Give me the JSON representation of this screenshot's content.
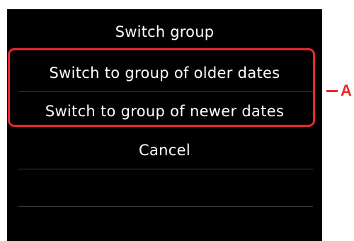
{
  "screen": {
    "title": "Switch group",
    "menu_items": [
      {
        "label": "Switch to group of older dates"
      },
      {
        "label": "Switch to group of newer dates"
      },
      {
        "label": "Cancel"
      }
    ]
  },
  "annotation": {
    "label": "A",
    "color": "#e8282e"
  },
  "colors": {
    "screen_background": "#000000",
    "text": "#ffffff",
    "divider": "#3a3a3a",
    "highlight": "#e8282e"
  }
}
